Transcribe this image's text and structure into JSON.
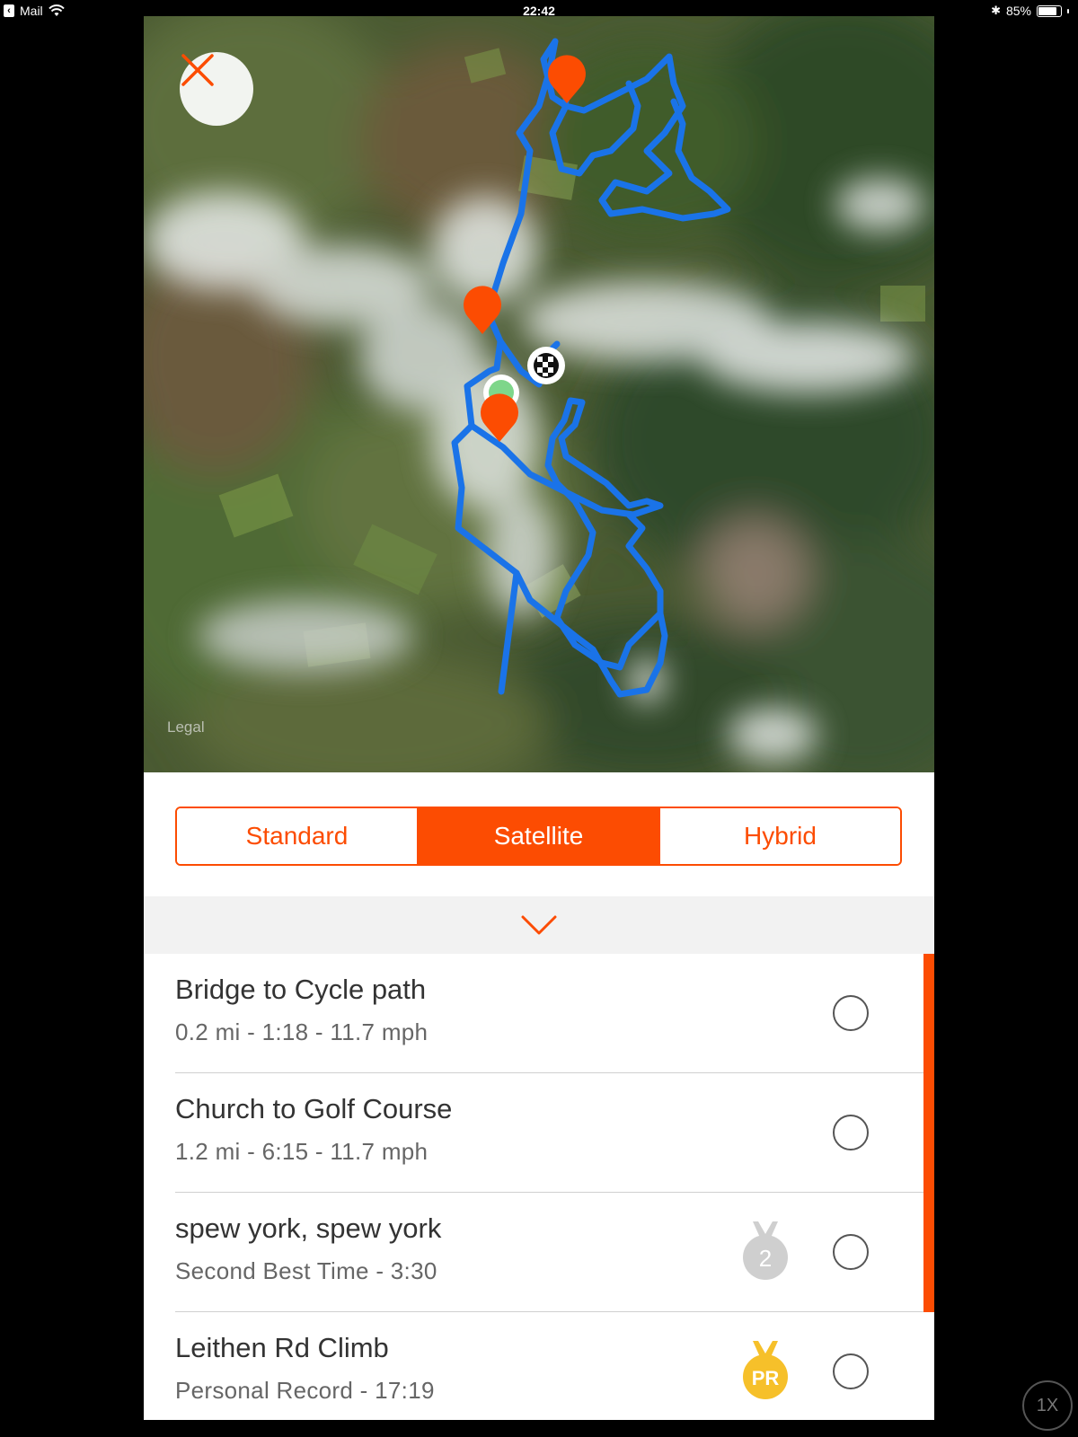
{
  "status_bar": {
    "back_app": "Mail",
    "time": "22:42",
    "battery": "85%",
    "battery_level": 0.85
  },
  "map": {
    "legal": "Legal",
    "close_icon": "close-x-icon",
    "markers": [
      "orange-pin-icon",
      "orange-pin-icon",
      "orange-pin-icon",
      "start-dot-icon",
      "finish-flag-icon"
    ]
  },
  "map_type": {
    "options": [
      "Standard",
      "Satellite",
      "Hybrid"
    ],
    "selected": "Satellite"
  },
  "collapse": {
    "icon": "chevron-down-icon"
  },
  "segments": [
    {
      "name": "Bridge to Cycle path",
      "detail": "0.2 mi - 1:18 - 11.7 mph",
      "badge": null,
      "highlighted": true
    },
    {
      "name": "Church to Golf Course",
      "detail": "1.2 mi - 6:15 - 11.7 mph",
      "badge": null,
      "highlighted": true
    },
    {
      "name": "spew york, spew york",
      "detail": "Second Best Time - 3:30",
      "badge": "2",
      "highlighted": true
    },
    {
      "name": "Leithen Rd Climb",
      "detail": "Personal Record - 17:19",
      "badge": "PR",
      "highlighted": false
    }
  ],
  "colors": {
    "accent": "#fc4c02",
    "route": "#1a73e8",
    "medal_silver": "#cfcfcf",
    "medal_gold": "#f6c02a"
  },
  "zoom_badge": "1X"
}
